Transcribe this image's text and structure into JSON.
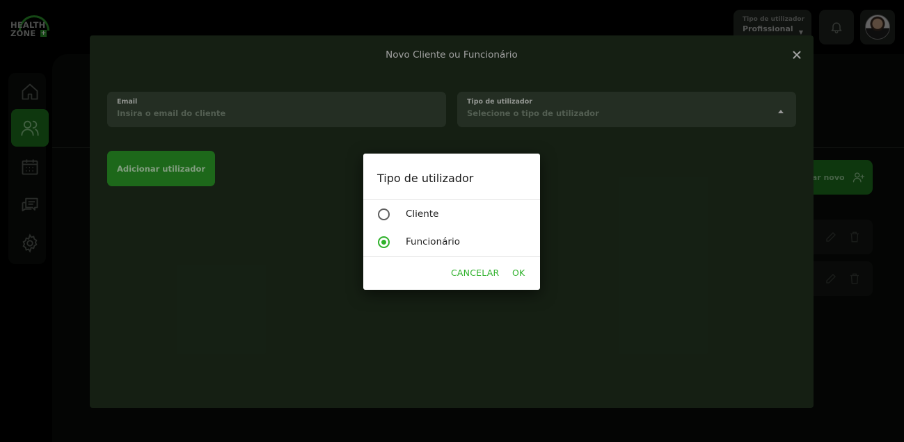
{
  "app": {
    "logo_line1": "HEALTH",
    "logo_line2": "ZONE",
    "logo_plus": "+"
  },
  "header": {
    "role_label": "Tipo de utilizador",
    "role_value": "Profissional",
    "bell_icon": "bell-icon",
    "avatar_icon": "user-avatar"
  },
  "sidebar": {
    "items": [
      {
        "icon": "home-icon",
        "active": false
      },
      {
        "icon": "users-icon",
        "active": true
      },
      {
        "icon": "calendar-icon",
        "active": false
      },
      {
        "icon": "chat-icon",
        "active": false
      },
      {
        "icon": "settings-icon",
        "active": false
      }
    ]
  },
  "background": {
    "add_new_label": "lar novo"
  },
  "modal": {
    "title": "Novo Cliente ou Funcionário",
    "close_icon": "close-icon",
    "email_label": "Email",
    "email_placeholder": "Insira o email do cliente",
    "type_label": "Tipo de utilizador",
    "type_placeholder": "Selecione o tipo de utilizador",
    "add_button": "Adicionar utilizador"
  },
  "dialog": {
    "title": "Tipo de utilizador",
    "options": [
      {
        "label": "Cliente",
        "selected": false
      },
      {
        "label": "Funcionário",
        "selected": true
      }
    ],
    "cancel_label": "CANCELAR",
    "ok_label": "OK"
  },
  "colors": {
    "accent": "#2fb12b",
    "modal_bg": "#1f2f1d",
    "field_bg": "#354534",
    "button_bg": "#2c9a27"
  }
}
